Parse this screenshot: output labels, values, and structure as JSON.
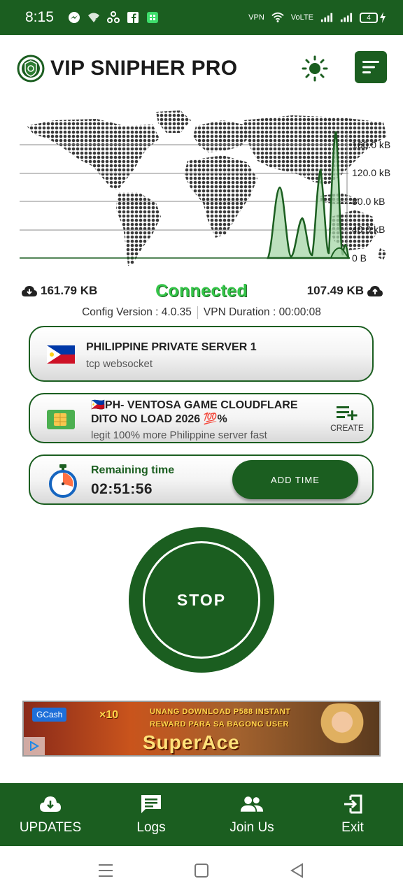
{
  "status_bar": {
    "time": "8:15",
    "battery": "4",
    "network_label": "VoLTE",
    "vpn_label": "VPN"
  },
  "header": {
    "title": "VIP SNIPHER PRO"
  },
  "graph": {
    "y_ticks": [
      "160.0 kB",
      "120.0 kB",
      "80.0 kB",
      "40.0 kB",
      "0 B"
    ]
  },
  "traffic": {
    "download": "161.79 KB",
    "upload": "107.49 KB",
    "status": "Connected"
  },
  "info": {
    "config_version": "Config Version : 4.0.35",
    "vpn_duration": "VPN Duration : 00:00:08"
  },
  "server": {
    "name": "PHILIPPINE PRIVATE SERVER 1",
    "protocol": "tcp websocket"
  },
  "config": {
    "title_line1": "🇵🇭PH- VENTOSA GAME CLOUDFLARE",
    "title_line2": "DITO NO LOAD 2026 💯%",
    "description": "legit 100% more Philippine server fast",
    "create_label": "CREATE"
  },
  "timer": {
    "label": "Remaining time",
    "value": "02:51:56",
    "add_time_label": "ADD TIME"
  },
  "stop_button": {
    "label": "STOP"
  },
  "ad": {
    "brand_tag": "GCash",
    "multiplier": "×10",
    "line1": "UNANG DOWNLOAD P588 INSTANT",
    "line2": "REWARD PARA SA BAGONG USER",
    "brand": "SuperAce"
  },
  "bottom_nav": {
    "items": [
      {
        "label": "UPDATES",
        "icon": "cloud-download-icon"
      },
      {
        "label": "Logs",
        "icon": "chat-icon"
      },
      {
        "label": "Join Us",
        "icon": "group-icon"
      },
      {
        "label": "Exit",
        "icon": "exit-icon"
      }
    ]
  },
  "colors": {
    "primary": "#1b5e20",
    "connected": "#33c447"
  }
}
